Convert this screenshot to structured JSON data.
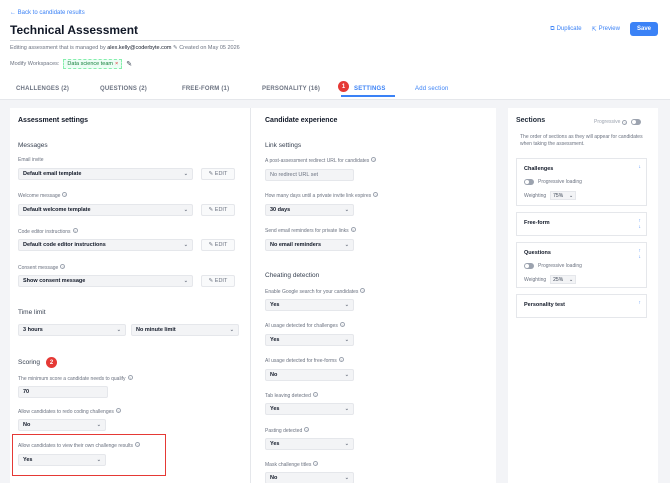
{
  "header": {
    "back_link": "← Back to candidate results",
    "title": "Technical Assessment",
    "managed_prefix": "Editing assessment that is managed by",
    "managed_email": "alex.kelly@coderbyte.com",
    "created_text": "Created on May 05 2026",
    "workspaces_label": "Modify Workspaces:",
    "workspace_tag": "Data science team",
    "duplicate_label": "Duplicate",
    "preview_label": "Preview",
    "save_label": "Save"
  },
  "tabs": [
    {
      "label": "CHALLENGES (2)"
    },
    {
      "label": "QUESTIONS (2)"
    },
    {
      "label": "FREE-FORM (1)"
    },
    {
      "label": "PERSONALITY (16)"
    },
    {
      "label": "SETTINGS"
    },
    {
      "label": "Add section"
    }
  ],
  "markers": {
    "one": "1",
    "two": "2"
  },
  "assessment_settings": {
    "title": "Assessment settings",
    "messages_title": "Messages",
    "email_invite_label": "Email invite",
    "email_invite_value": "Default email template",
    "welcome_label": "Welcome message",
    "welcome_value": "Default welcome template",
    "code_editor_label": "Code editor instructions",
    "code_editor_value": "Default code editor instructions",
    "consent_label": "Consent message",
    "consent_value": "Show consent message",
    "edit_label": "EDIT",
    "time_limit_title": "Time limit",
    "time_limit_hours": "3 hours",
    "time_limit_minutes": "No minute limit",
    "scoring_title": "Scoring",
    "min_score_label": "The minimum score a candidate needs to qualify",
    "min_score_value": "70",
    "redo_label": "Allow candidates to redo coding challenges",
    "redo_value": "No",
    "view_results_label": "Allow candidates to view their own challenge results",
    "view_results_value": "Yes"
  },
  "candidate_experience": {
    "title": "Candidate experience",
    "link_settings_title": "Link settings",
    "redirect_label": "A post-assessment redirect URL for candidates",
    "redirect_placeholder": "No redirect URL set",
    "expires_label": "How many days until a private invite link expires",
    "expires_value": "30 days",
    "reminders_label": "Send email reminders for private links",
    "reminders_value": "No email reminders",
    "cheating_title": "Cheating detection",
    "google_label": "Enable Google search for your candidates",
    "google_value": "Yes",
    "ai_challenges_label": "AI usage detected for challenges",
    "ai_challenges_value": "Yes",
    "ai_freeform_label": "AI usage detected for free-forms",
    "ai_freeform_value": "No",
    "tab_leaving_label": "Tab leaving detected",
    "tab_leaving_value": "Yes",
    "pasting_label": "Pasting detected",
    "pasting_value": "Yes",
    "mask_label": "Mask challenge titles",
    "mask_value": "No"
  },
  "sections": {
    "title": "Sections",
    "progressive_label": "Progressive",
    "description": "The order of sections as they will appear for candidates when taking the assessment.",
    "challenges_name": "Challenges",
    "challenges_progressive": "Progressive loading",
    "challenges_weighting_label": "Weighting",
    "challenges_weighting_value": "75%",
    "freeform_name": "Free-form",
    "questions_name": "Questions",
    "questions_progressive": "Progressive loading",
    "questions_weighting_label": "Weighting",
    "questions_weighting_value": "25%",
    "personality_name": "Personality test"
  }
}
